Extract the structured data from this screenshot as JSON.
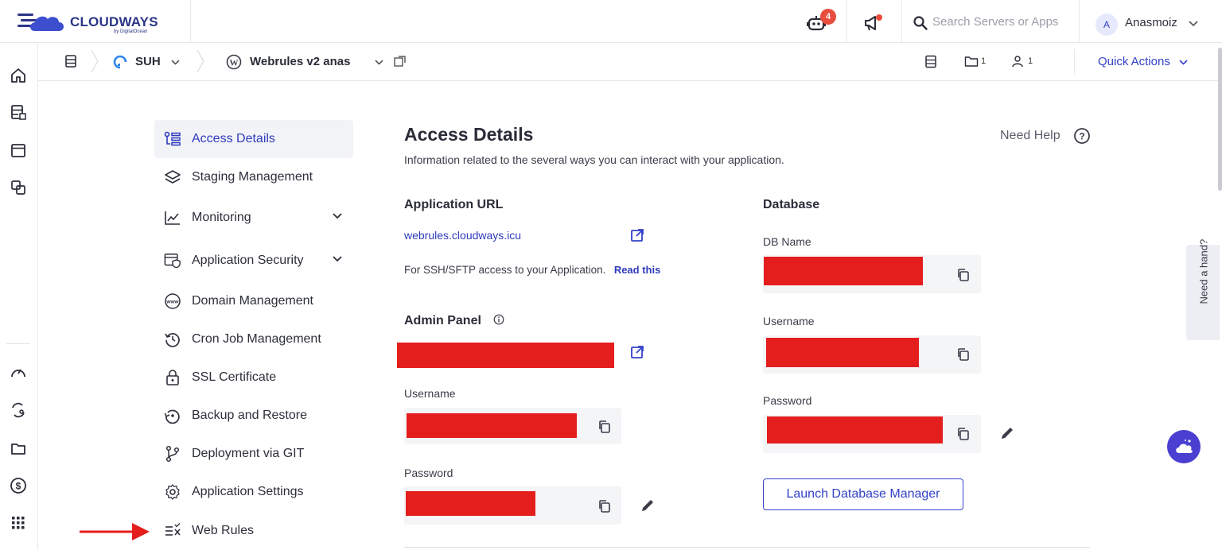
{
  "brand": {
    "name": "CLOUDWAYS",
    "sub": "by DigitalOcean"
  },
  "topbar": {
    "notification_count": "4",
    "search_placeholder": "Search Servers or Apps",
    "avatar_initial": "A",
    "username": "Anasmoiz"
  },
  "breadcrumb": {
    "server": "SUH",
    "app": "Webrules v2 anas",
    "folders_count": "1",
    "users_count": "1",
    "quick_actions": "Quick Actions"
  },
  "sidenav": {
    "items": [
      {
        "label": "Access Details",
        "icon": "access-details-icon"
      },
      {
        "label": "Staging Management",
        "icon": "layers-icon"
      },
      {
        "label": "Monitoring",
        "icon": "chart-line-icon"
      },
      {
        "label": "Application Security",
        "icon": "shield-window-icon"
      },
      {
        "label": "Domain Management",
        "icon": "www-icon"
      },
      {
        "label": "Cron Job Management",
        "icon": "history-icon"
      },
      {
        "label": "SSL Certificate",
        "icon": "lock-icon"
      },
      {
        "label": "Backup and Restore",
        "icon": "restore-icon"
      },
      {
        "label": "Deployment via GIT",
        "icon": "git-branch-icon"
      },
      {
        "label": "Application Settings",
        "icon": "gear-icon"
      },
      {
        "label": "Web Rules",
        "icon": "rules-icon"
      }
    ]
  },
  "main": {
    "title": "Access Details",
    "subtitle": "Information related to the several ways you can interact with your application.",
    "need_help": "Need Help",
    "app_url": {
      "title": "Application URL",
      "url": "webrules.cloudways.icu",
      "ssh_text": "For SSH/SFTP access to your Application.",
      "read_this": "Read this"
    },
    "admin_panel": {
      "title": "Admin Panel",
      "username_label": "Username",
      "password_label": "Password"
    },
    "database": {
      "title": "Database",
      "db_name_label": "DB Name",
      "username_label": "Username",
      "password_label": "Password",
      "launch_button": "Launch Database Manager"
    }
  },
  "right_edge": {
    "need_a_hand": "Need a hand?"
  },
  "colors": {
    "accent": "#3342c8",
    "redaction": "#e41d1d",
    "badge": "#e84c3d",
    "arrow": "#e41d1d"
  }
}
